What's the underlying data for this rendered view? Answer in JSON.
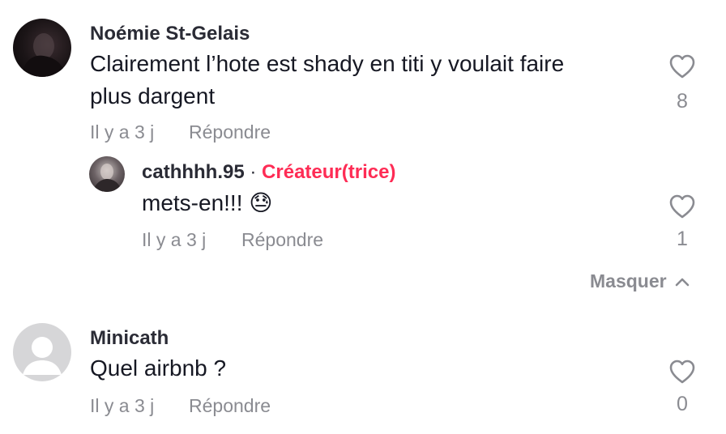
{
  "comments": [
    {
      "username": "Noémie St-Gelais",
      "text_line1": "Clairement l’hote est shady en titi y voulait faire",
      "text_line2": "plus dargent",
      "time": "Il y a 3 j",
      "reply_label": "Répondre",
      "likes": "8",
      "reply": {
        "username": "cathhhh.95",
        "separator": "·",
        "badge": "Créateur(trice)",
        "text": "mets-en!!! 😓",
        "time": "Il y a 3 j",
        "reply_label": "Répondre",
        "likes": "1"
      }
    },
    {
      "username": "Minicath",
      "text": "Quel airbnb ?",
      "time": "Il y a 3 j",
      "reply_label": "Répondre",
      "likes": "0"
    }
  ],
  "hide_replies_label": "Masquer",
  "icons": {
    "like": "heart-outline-icon",
    "collapse": "chevron-up-icon"
  },
  "colors": {
    "creator_badge": "#fe2c55",
    "muted": "#8a8b91"
  }
}
